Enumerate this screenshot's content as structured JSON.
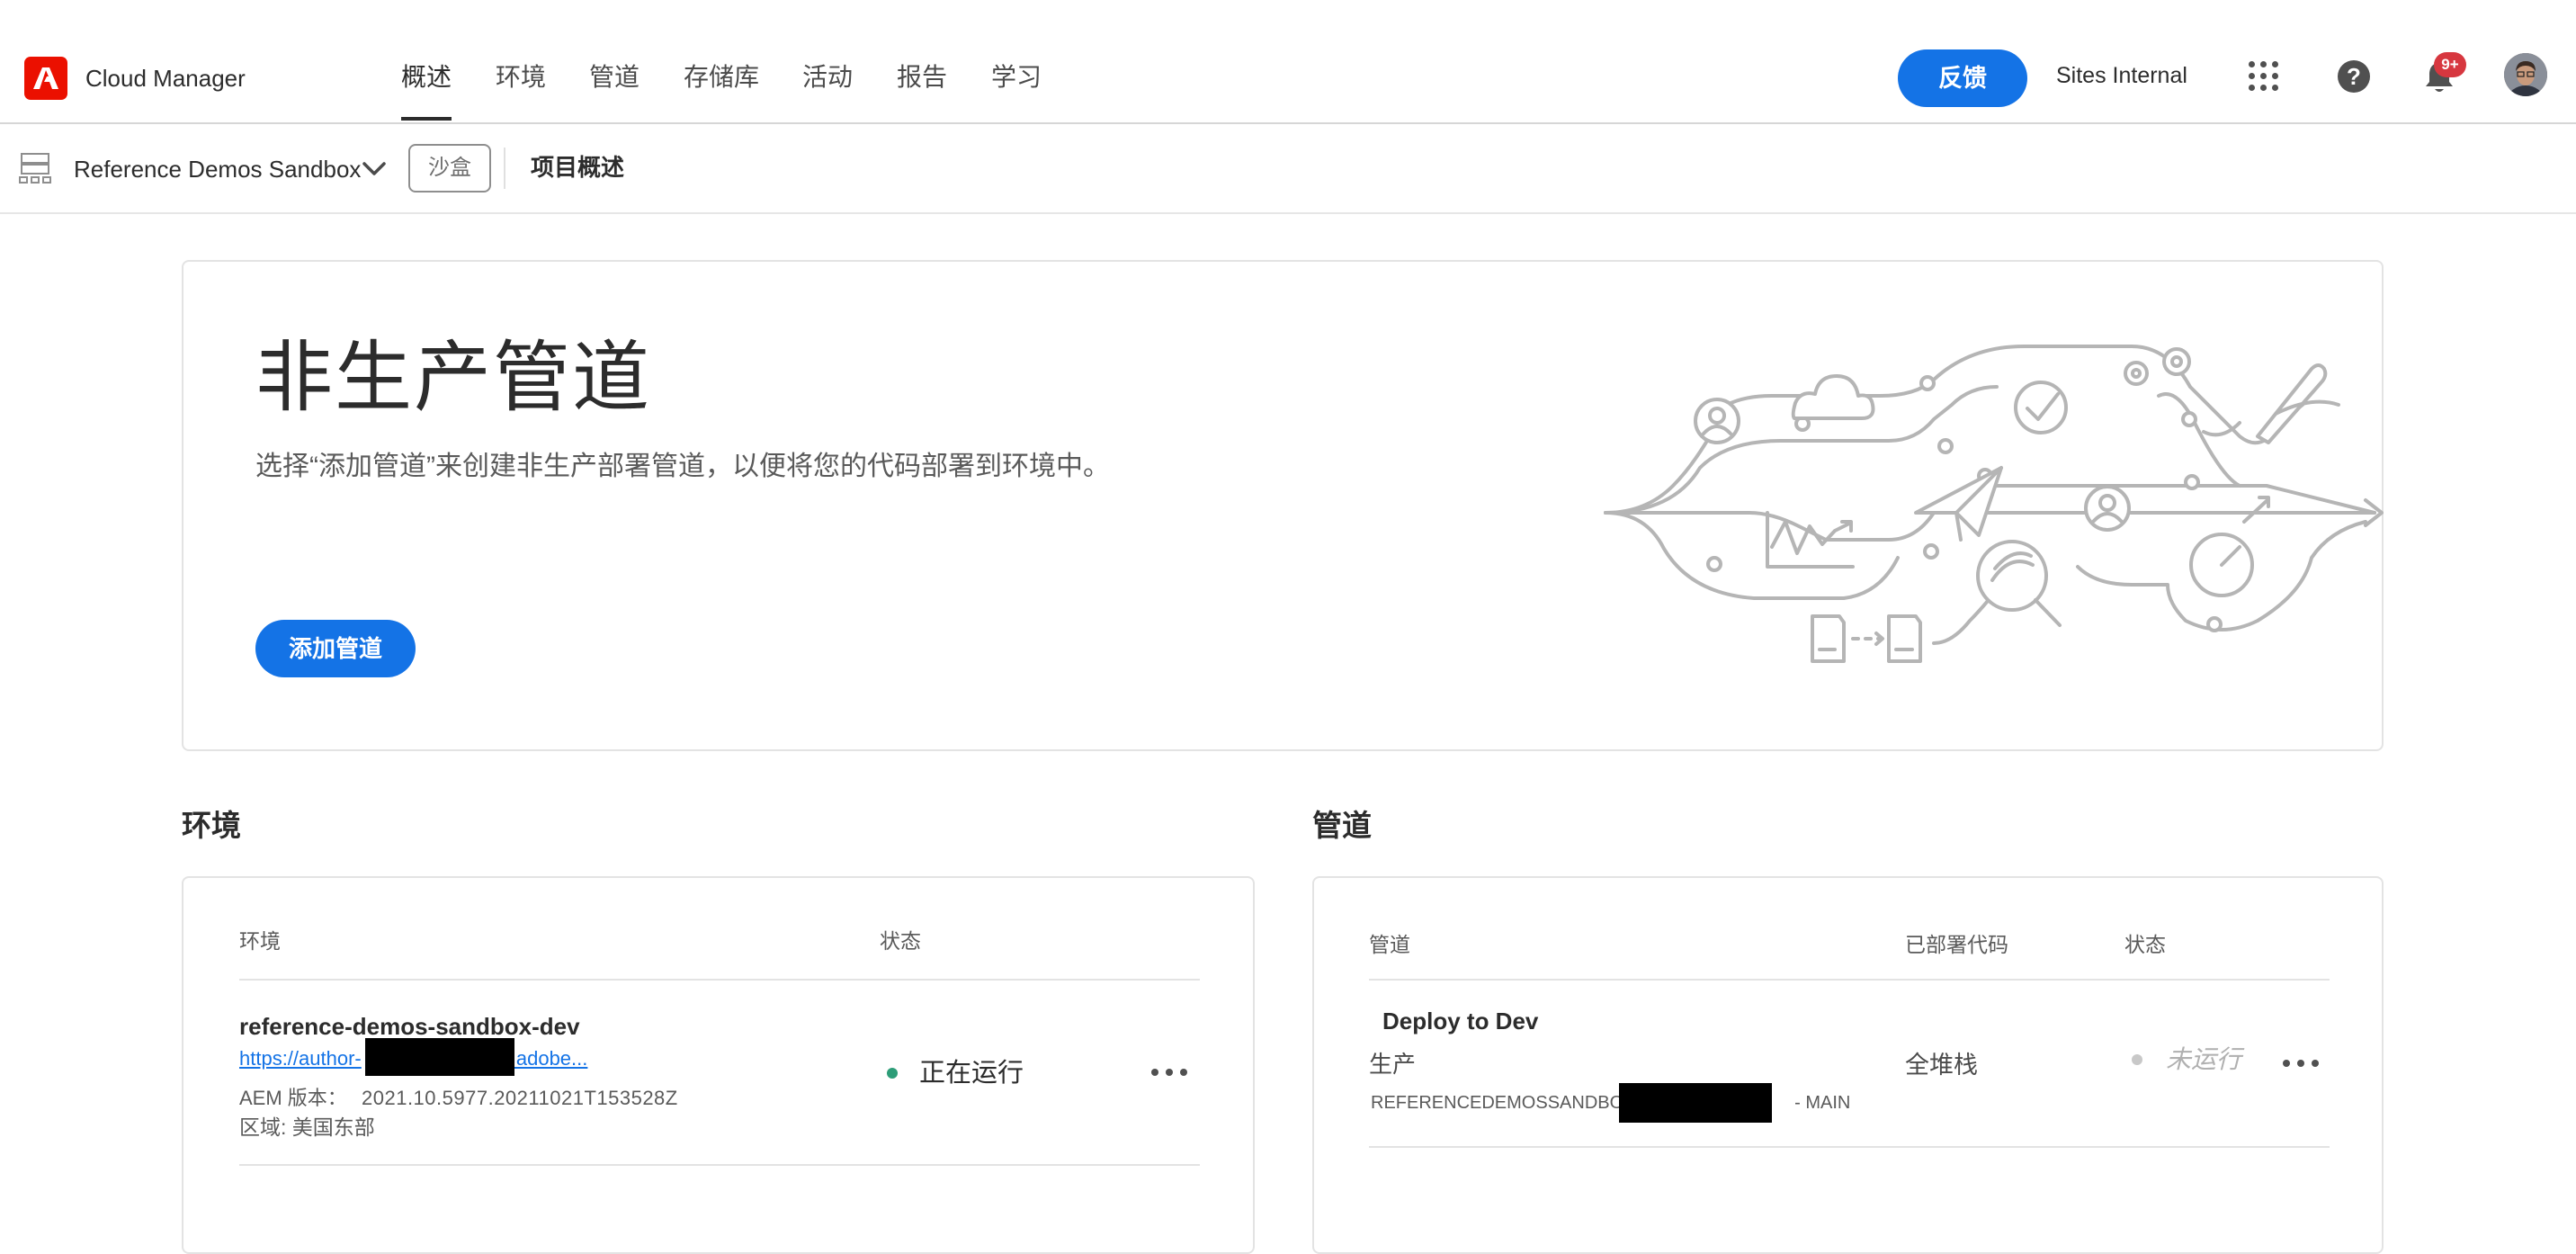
{
  "header": {
    "app_title": "Cloud Manager",
    "nav_tabs": [
      {
        "label": "概述",
        "active": true
      },
      {
        "label": "环境",
        "active": false
      },
      {
        "label": "管道",
        "active": false
      },
      {
        "label": "存储库",
        "active": false
      },
      {
        "label": "活动",
        "active": false
      },
      {
        "label": "报告",
        "active": false
      },
      {
        "label": "学习",
        "active": false
      }
    ],
    "feedback_label": "反馈",
    "org_name": "Sites Internal",
    "help_glyph": "?",
    "notification_count": "9+",
    "icons": [
      "adobe-logo-icon",
      "app-grid-icon",
      "help-icon",
      "bell-icon",
      "avatar"
    ]
  },
  "subheader": {
    "program_name": "Reference Demos Sandbox",
    "sandbox_badge": "沙盒",
    "page_crumb": "项目概述",
    "icons": [
      "program-icon",
      "chevron-down-icon"
    ]
  },
  "hero": {
    "title": "非生产管道",
    "description": "选择“添加管道”来创建非生产部署管道，以便将您的代码部署到环境中。",
    "add_button": "添加管道"
  },
  "environments": {
    "section_title": "环境",
    "columns": {
      "environment": "环境",
      "status": "状态"
    },
    "rows": [
      {
        "name": "reference-demos-sandbox-dev",
        "link_prefix": "https://author-",
        "link_suffix": ".adobe...",
        "aem_label": "AEM 版本：",
        "aem_version": "2021.10.5977.20211021T153528Z",
        "region": "区域: 美国东部",
        "status": "正在运行",
        "status_color": "#2d9d78"
      }
    ]
  },
  "pipelines": {
    "section_title": "管道",
    "columns": {
      "pipeline": "管道",
      "deployed_code": "已部署代码",
      "status": "状态"
    },
    "rows": [
      {
        "name": "Deploy to Dev",
        "type": "生产",
        "repo_prefix": "REFERENCEDEMOSSANDBOX-",
        "repo_suffix": "- MAIN",
        "deployed_code": "全堆栈",
        "status": "未运行",
        "status_color": "#c8c8c8"
      }
    ]
  },
  "colors": {
    "accent": "#1473e6",
    "adobe_red": "#eb1000",
    "badge_red": "#d7373f"
  }
}
